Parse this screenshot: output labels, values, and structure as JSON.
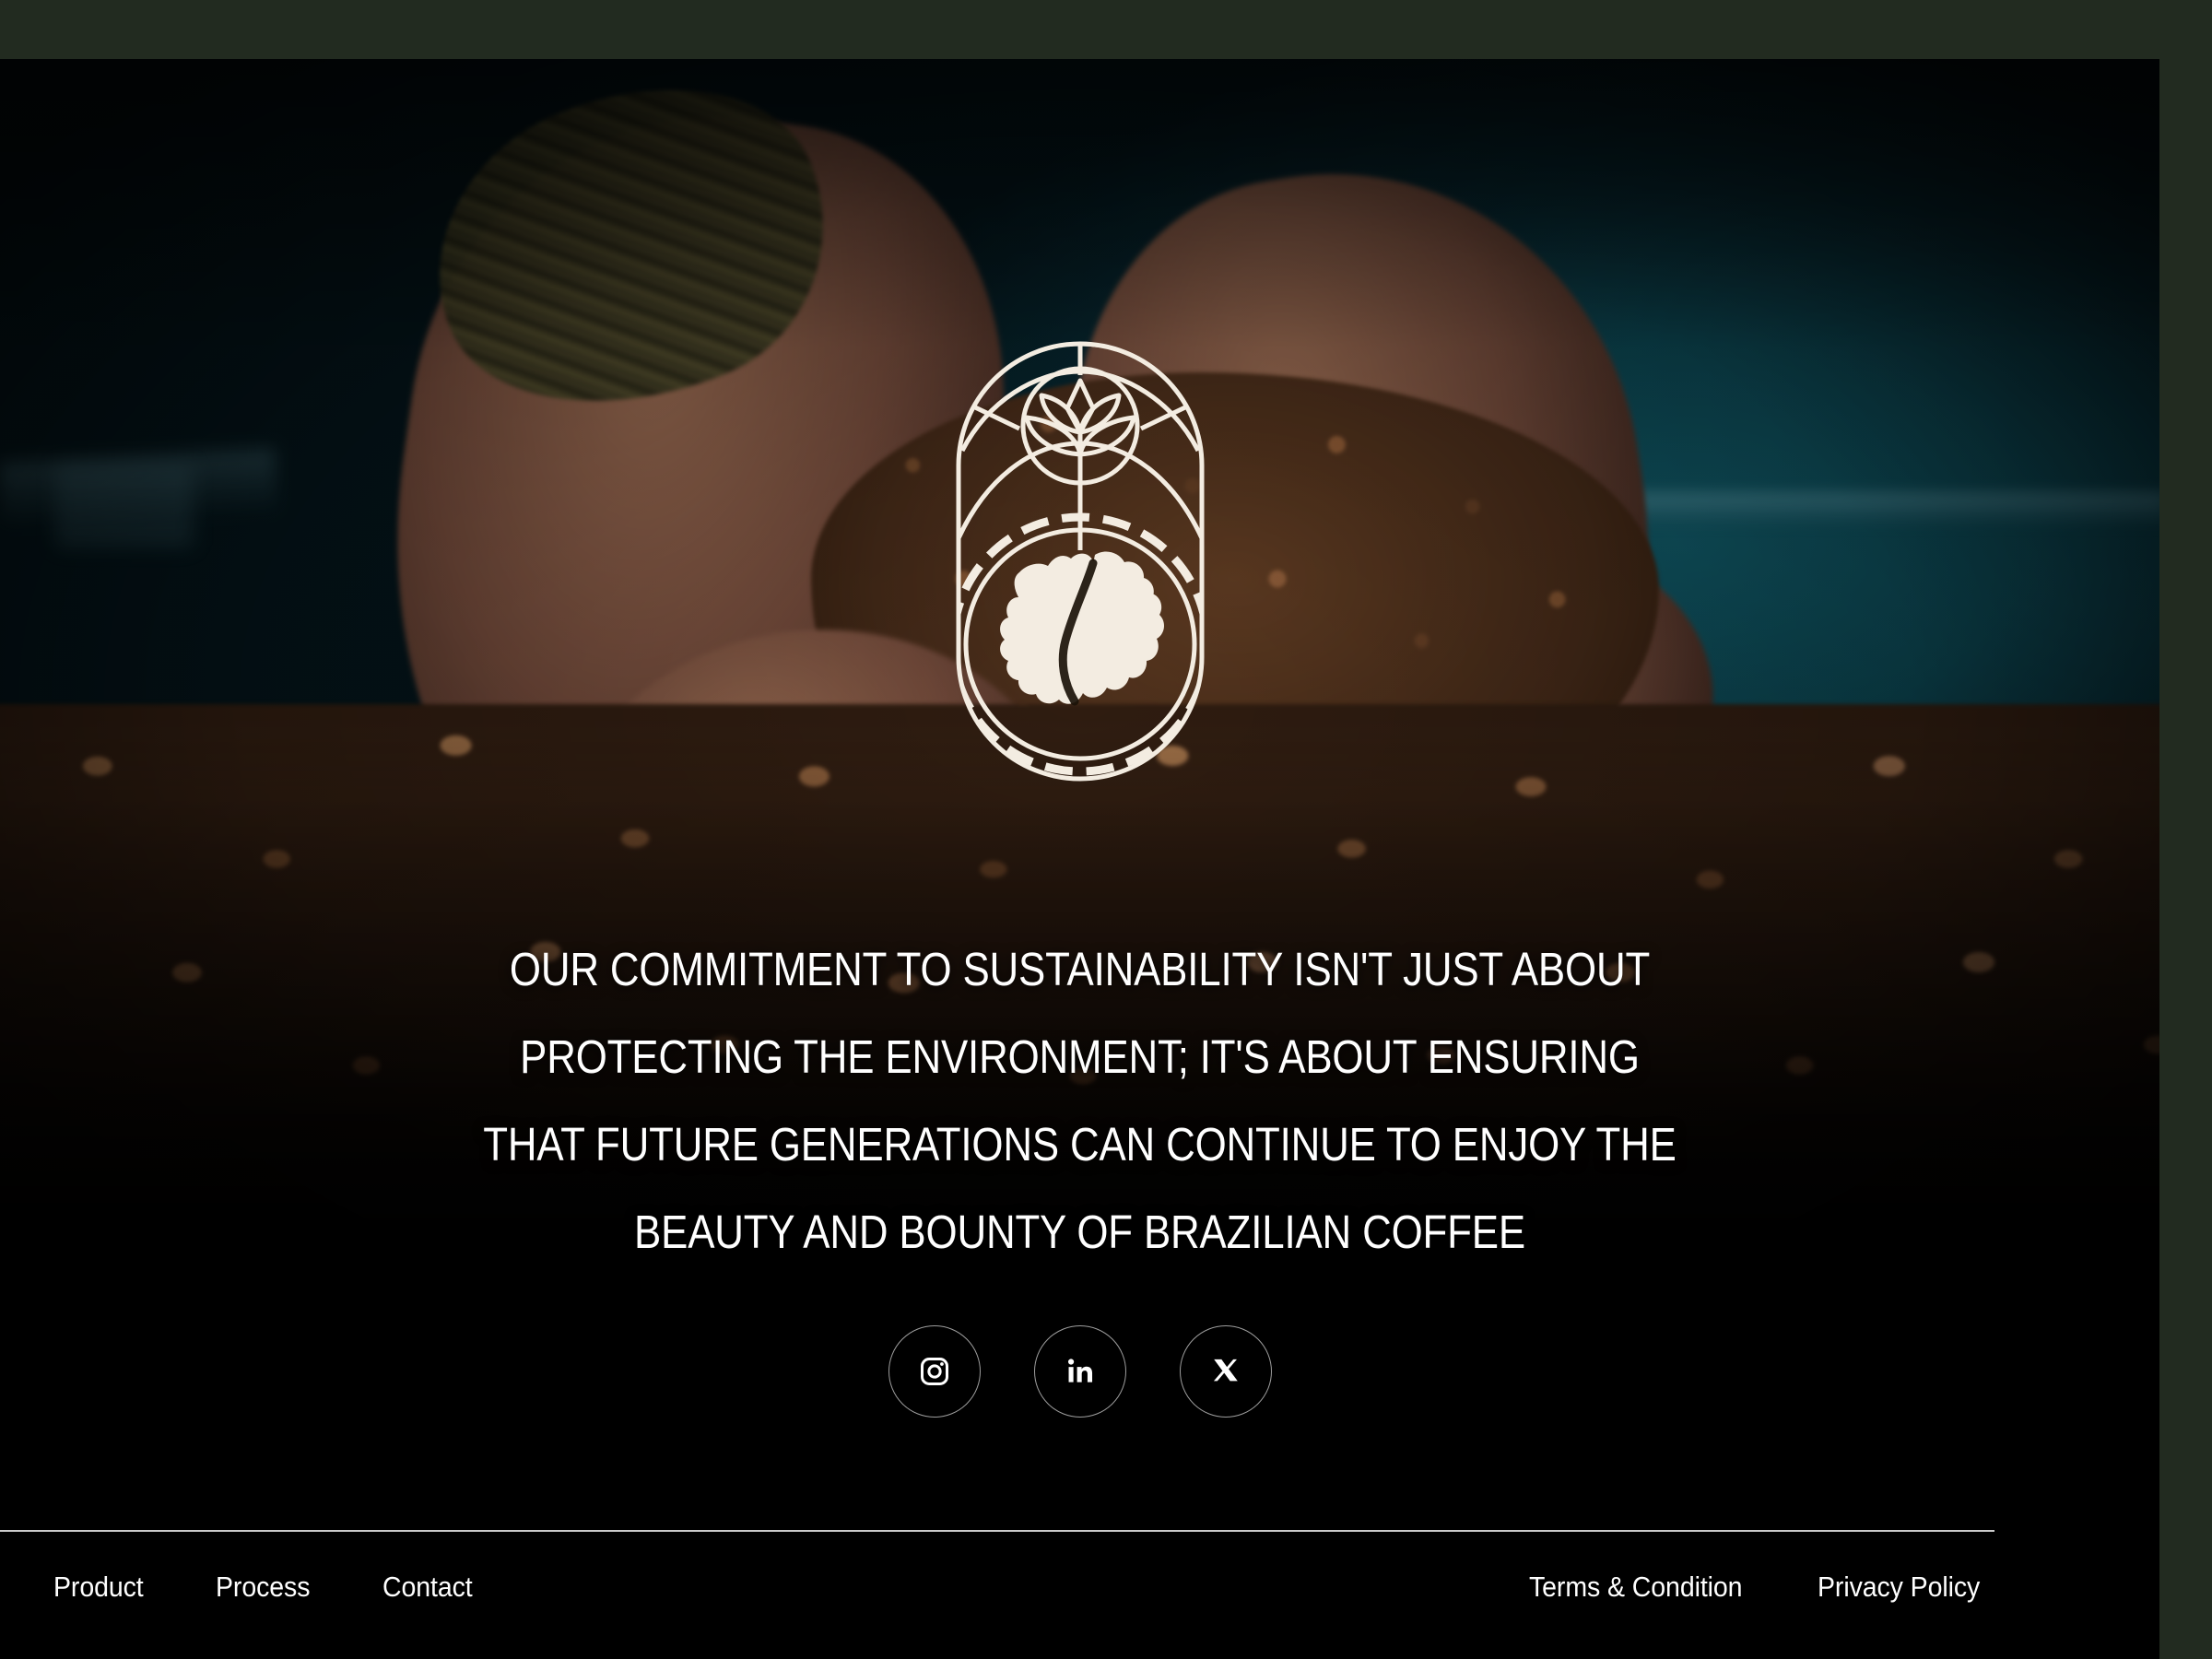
{
  "theme": {
    "frame_color": "#222b20",
    "panel_background": "#000000",
    "logo_color": "#f3ece1",
    "text_color": "#ffffff",
    "divider_color": "rgba(255,255,255,0.80)"
  },
  "brand": {
    "logo_name": "brazilian-coffee-emblem",
    "logo_description": "arched pill emblem containing a coffee-plant blossom inside a circle above a circular Brazil map"
  },
  "hero": {
    "background_description": "hands cupping roasted coffee beans above a teal bin, bean field in foreground",
    "headline": "OUR COMMITMENT TO SUSTAINABILITY ISN'T JUST ABOUT\nPROTECTING THE ENVIRONMENT; IT'S ABOUT ENSURING\nTHAT FUTURE GENERATIONS CAN CONTINUE TO ENJOY THE\nBEAUTY AND BOUNTY OF BRAZILIAN COFFEE",
    "headline_lines": [
      "OUR COMMITMENT TO SUSTAINABILITY ISN'T JUST ABOUT",
      "PROTECTING THE ENVIRONMENT; IT'S ABOUT ENSURING",
      "THAT FUTURE GENERATIONS CAN CONTINUE TO ENJOY THE",
      "BEAUTY AND BOUNTY OF BRAZILIAN COFFEE"
    ]
  },
  "socials": [
    {
      "name": "instagram",
      "icon": "instagram-icon",
      "label": "Instagram"
    },
    {
      "name": "linkedin",
      "icon": "linkedin-icon",
      "label": "LinkedIn"
    },
    {
      "name": "x",
      "icon": "x-twitter-icon",
      "label": "X"
    }
  ],
  "footer": {
    "nav_links": [
      {
        "label": "Product"
      },
      {
        "label": "Process"
      },
      {
        "label": "Contact"
      }
    ],
    "legal_links": [
      {
        "label": "Terms & Condition"
      },
      {
        "label": "Privacy Policy"
      }
    ]
  }
}
